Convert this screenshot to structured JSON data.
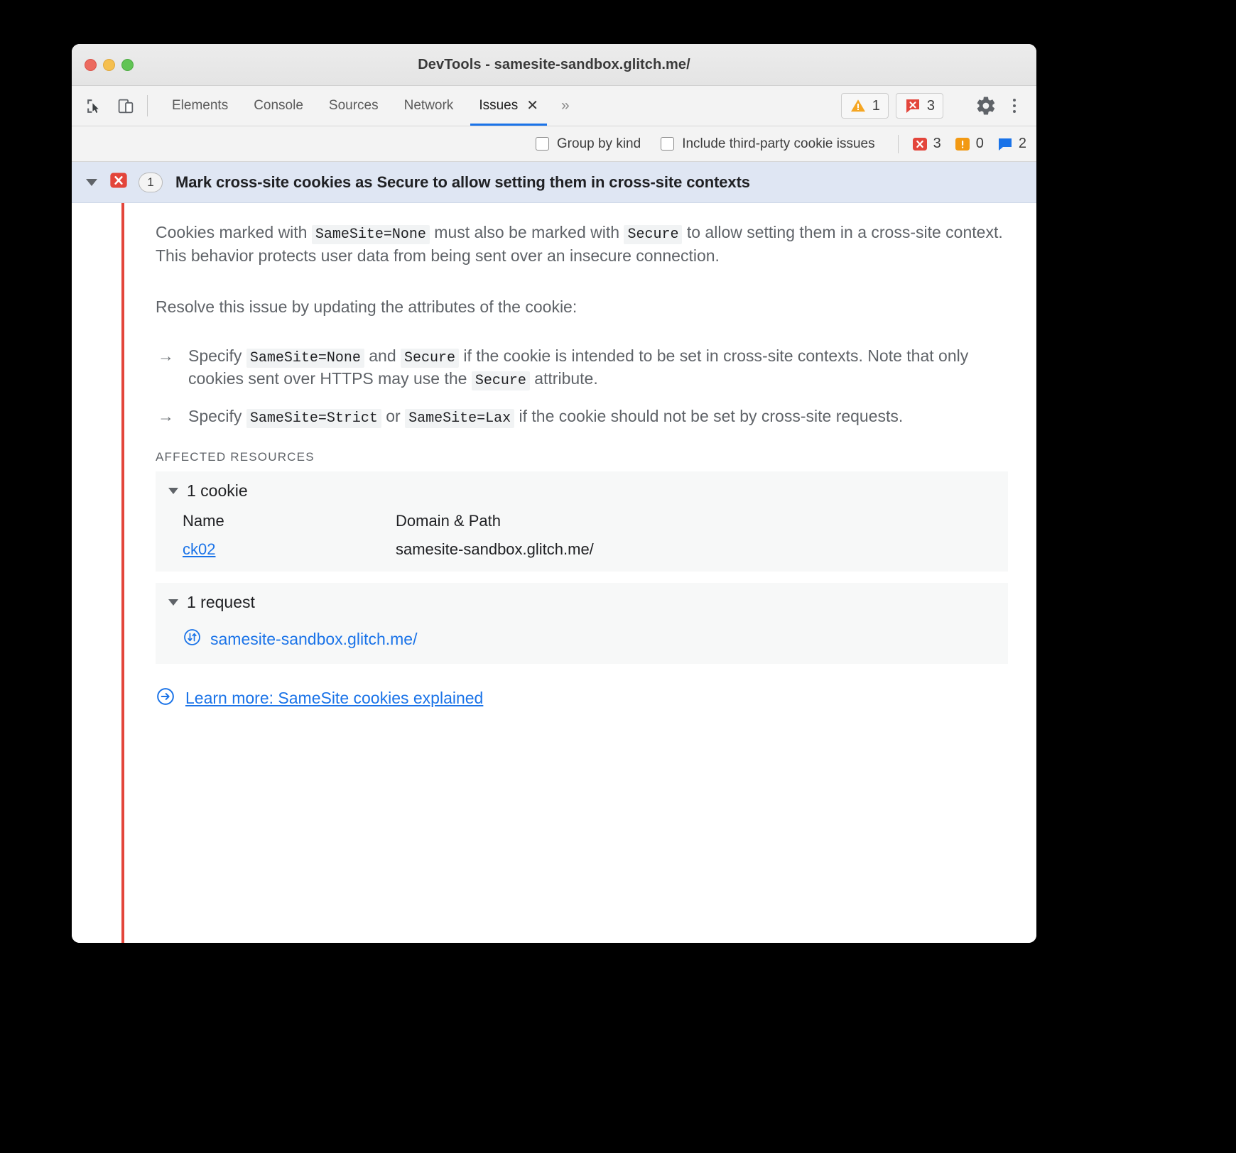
{
  "window": {
    "title": "DevTools - samesite-sandbox.glitch.me/",
    "traffic_lights": [
      "close",
      "minimize",
      "maximize"
    ]
  },
  "toolbar": {
    "icons": [
      "inspect-element-icon",
      "device-toolbar-icon"
    ],
    "tabs": [
      {
        "label": "Elements",
        "active": false
      },
      {
        "label": "Console",
        "active": false
      },
      {
        "label": "Sources",
        "active": false
      },
      {
        "label": "Network",
        "active": false
      },
      {
        "label": "Issues",
        "active": true,
        "closable": true
      }
    ],
    "tab_close_glyph": "✕",
    "overflow_glyph": "»",
    "warning_count": "1",
    "error_count": "3",
    "settings_icon": "gear-icon",
    "more_icon": "kebab-menu-icon"
  },
  "filter_bar": {
    "group_by_kind": {
      "label": "Group by kind",
      "checked": false
    },
    "include_third_party": {
      "label": "Include third-party cookie issues",
      "checked": false
    },
    "counters": [
      {
        "icon": "error-icon",
        "value": "3",
        "color": "#e3453b"
      },
      {
        "icon": "warning-icon",
        "value": "0",
        "color": "#f29913"
      },
      {
        "icon": "info-icon",
        "value": "2",
        "color": "#1a73e8"
      }
    ]
  },
  "issue": {
    "expanded": true,
    "severity_icon": "error-icon",
    "count": "1",
    "title": "Mark cross-site cookies as Secure to allow setting them in cross-site contexts",
    "paragraph1": {
      "part1": "Cookies marked with ",
      "code1": "SameSite=None",
      "part2": " must also be marked with ",
      "code2": "Secure",
      "part3": " to allow setting them in a cross-site context. This behavior protects user data from being sent over an insecure connection."
    },
    "paragraph2": "Resolve this issue by updating the attributes of the cookie:",
    "bullets": [
      {
        "arrow": "→",
        "part1": "Specify ",
        "code1": "SameSite=None",
        "part2": " and ",
        "code2": "Secure",
        "part3": " if the cookie is intended to be set in cross-site contexts. Note that only cookies sent over HTTPS may use the ",
        "code3": "Secure",
        "part4": " attribute."
      },
      {
        "arrow": "→",
        "part1": "Specify ",
        "code1": "SameSite=Strict",
        "part2": " or ",
        "code2": "SameSite=Lax",
        "part3": " if the cookie should not be set by cross-site requests."
      }
    ],
    "affected_resources_label": "AFFECTED RESOURCES",
    "cookie_section": {
      "summary": "1 cookie",
      "expanded": true,
      "columns": [
        "Name",
        "Domain & Path"
      ],
      "rows": [
        {
          "name": "ck02",
          "domain_path": "samesite-sandbox.glitch.me/"
        }
      ]
    },
    "request_section": {
      "summary": "1 request",
      "expanded": true,
      "rows": [
        {
          "icon": "request-arrows-icon",
          "url": "samesite-sandbox.glitch.me/"
        }
      ]
    },
    "learn_more": {
      "icon": "arrow-in-circle-icon",
      "label": "Learn more: SameSite cookies explained"
    }
  },
  "colors": {
    "accent": "#1a73e8",
    "error": "#e3453b",
    "warning": "#f29913",
    "issue_header_bg": "#dfe6f3",
    "resource_bg": "#f7f8f8"
  }
}
